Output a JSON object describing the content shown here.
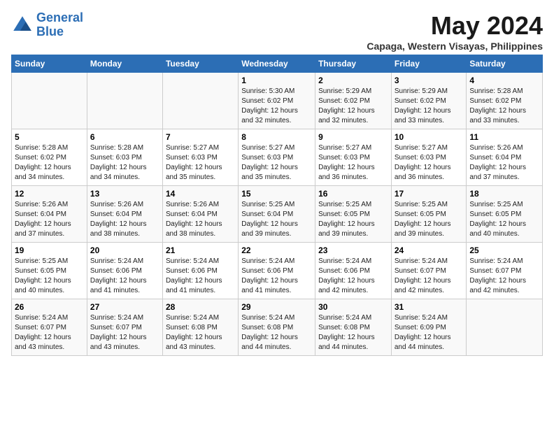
{
  "header": {
    "logo_line1": "General",
    "logo_line2": "Blue",
    "month": "May 2024",
    "location": "Capaga, Western Visayas, Philippines"
  },
  "weekdays": [
    "Sunday",
    "Monday",
    "Tuesday",
    "Wednesday",
    "Thursday",
    "Friday",
    "Saturday"
  ],
  "weeks": [
    [
      {
        "day": "",
        "info": ""
      },
      {
        "day": "",
        "info": ""
      },
      {
        "day": "",
        "info": ""
      },
      {
        "day": "1",
        "info": "Sunrise: 5:30 AM\nSunset: 6:02 PM\nDaylight: 12 hours\nand 32 minutes."
      },
      {
        "day": "2",
        "info": "Sunrise: 5:29 AM\nSunset: 6:02 PM\nDaylight: 12 hours\nand 32 minutes."
      },
      {
        "day": "3",
        "info": "Sunrise: 5:29 AM\nSunset: 6:02 PM\nDaylight: 12 hours\nand 33 minutes."
      },
      {
        "day": "4",
        "info": "Sunrise: 5:28 AM\nSunset: 6:02 PM\nDaylight: 12 hours\nand 33 minutes."
      }
    ],
    [
      {
        "day": "5",
        "info": "Sunrise: 5:28 AM\nSunset: 6:02 PM\nDaylight: 12 hours\nand 34 minutes."
      },
      {
        "day": "6",
        "info": "Sunrise: 5:28 AM\nSunset: 6:03 PM\nDaylight: 12 hours\nand 34 minutes."
      },
      {
        "day": "7",
        "info": "Sunrise: 5:27 AM\nSunset: 6:03 PM\nDaylight: 12 hours\nand 35 minutes."
      },
      {
        "day": "8",
        "info": "Sunrise: 5:27 AM\nSunset: 6:03 PM\nDaylight: 12 hours\nand 35 minutes."
      },
      {
        "day": "9",
        "info": "Sunrise: 5:27 AM\nSunset: 6:03 PM\nDaylight: 12 hours\nand 36 minutes."
      },
      {
        "day": "10",
        "info": "Sunrise: 5:27 AM\nSunset: 6:03 PM\nDaylight: 12 hours\nand 36 minutes."
      },
      {
        "day": "11",
        "info": "Sunrise: 5:26 AM\nSunset: 6:04 PM\nDaylight: 12 hours\nand 37 minutes."
      }
    ],
    [
      {
        "day": "12",
        "info": "Sunrise: 5:26 AM\nSunset: 6:04 PM\nDaylight: 12 hours\nand 37 minutes."
      },
      {
        "day": "13",
        "info": "Sunrise: 5:26 AM\nSunset: 6:04 PM\nDaylight: 12 hours\nand 38 minutes."
      },
      {
        "day": "14",
        "info": "Sunrise: 5:26 AM\nSunset: 6:04 PM\nDaylight: 12 hours\nand 38 minutes."
      },
      {
        "day": "15",
        "info": "Sunrise: 5:25 AM\nSunset: 6:04 PM\nDaylight: 12 hours\nand 39 minutes."
      },
      {
        "day": "16",
        "info": "Sunrise: 5:25 AM\nSunset: 6:05 PM\nDaylight: 12 hours\nand 39 minutes."
      },
      {
        "day": "17",
        "info": "Sunrise: 5:25 AM\nSunset: 6:05 PM\nDaylight: 12 hours\nand 39 minutes."
      },
      {
        "day": "18",
        "info": "Sunrise: 5:25 AM\nSunset: 6:05 PM\nDaylight: 12 hours\nand 40 minutes."
      }
    ],
    [
      {
        "day": "19",
        "info": "Sunrise: 5:25 AM\nSunset: 6:05 PM\nDaylight: 12 hours\nand 40 minutes."
      },
      {
        "day": "20",
        "info": "Sunrise: 5:24 AM\nSunset: 6:06 PM\nDaylight: 12 hours\nand 41 minutes."
      },
      {
        "day": "21",
        "info": "Sunrise: 5:24 AM\nSunset: 6:06 PM\nDaylight: 12 hours\nand 41 minutes."
      },
      {
        "day": "22",
        "info": "Sunrise: 5:24 AM\nSunset: 6:06 PM\nDaylight: 12 hours\nand 41 minutes."
      },
      {
        "day": "23",
        "info": "Sunrise: 5:24 AM\nSunset: 6:06 PM\nDaylight: 12 hours\nand 42 minutes."
      },
      {
        "day": "24",
        "info": "Sunrise: 5:24 AM\nSunset: 6:07 PM\nDaylight: 12 hours\nand 42 minutes."
      },
      {
        "day": "25",
        "info": "Sunrise: 5:24 AM\nSunset: 6:07 PM\nDaylight: 12 hours\nand 42 minutes."
      }
    ],
    [
      {
        "day": "26",
        "info": "Sunrise: 5:24 AM\nSunset: 6:07 PM\nDaylight: 12 hours\nand 43 minutes."
      },
      {
        "day": "27",
        "info": "Sunrise: 5:24 AM\nSunset: 6:07 PM\nDaylight: 12 hours\nand 43 minutes."
      },
      {
        "day": "28",
        "info": "Sunrise: 5:24 AM\nSunset: 6:08 PM\nDaylight: 12 hours\nand 43 minutes."
      },
      {
        "day": "29",
        "info": "Sunrise: 5:24 AM\nSunset: 6:08 PM\nDaylight: 12 hours\nand 44 minutes."
      },
      {
        "day": "30",
        "info": "Sunrise: 5:24 AM\nSunset: 6:08 PM\nDaylight: 12 hours\nand 44 minutes."
      },
      {
        "day": "31",
        "info": "Sunrise: 5:24 AM\nSunset: 6:09 PM\nDaylight: 12 hours\nand 44 minutes."
      },
      {
        "day": "",
        "info": ""
      }
    ]
  ]
}
